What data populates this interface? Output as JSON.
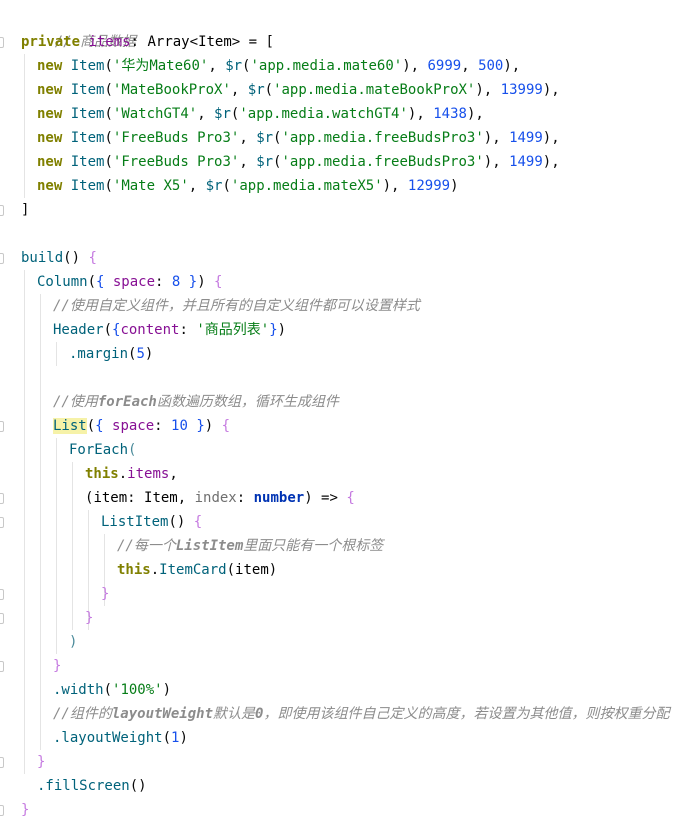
{
  "code": {
    "c_items": "// 商品数据",
    "kw_private": "private",
    "prop_items": "items",
    "type_array": "Array",
    "type_item": "Item",
    "kw_new": "new",
    "rows": [
      {
        "name": "'华为Mate60'",
        "res": "'app.media.mate60'",
        "price": "6999",
        "discount": "500"
      },
      {
        "name": "'MateBookProX'",
        "res": "'app.media.mateBookProX'",
        "price": "13999"
      },
      {
        "name": "'WatchGT4'",
        "res": "'app.media.watchGT4'",
        "price": "1438"
      },
      {
        "name": "'FreeBuds Pro3'",
        "res": "'app.media.freeBudsPro3'",
        "price": "1499"
      },
      {
        "name": "'FreeBuds Pro3'",
        "res": "'app.media.freeBudsPro3'",
        "price": "1499"
      },
      {
        "name": "'Mate X5'",
        "res": "'app.media.mateX5'",
        "price": "12999"
      }
    ],
    "fn_build": "build",
    "fn_column": "Column",
    "param_space": "space",
    "num_8": "8",
    "c_custom": "//使用自定义组件，并且所有的自定义组件都可以设置样式",
    "fn_header": "Header",
    "param_content": "content",
    "str_header": "'商品列表'",
    "fn_margin": ".margin",
    "num_5": "5",
    "c_foreach_a": "//使用",
    "c_foreach_b": "forEach",
    "c_foreach_c": "函数遍历数组，循环生成组件",
    "fn_list": "List",
    "num_10": "10",
    "fn_foreach": "ForEach",
    "kw_this": "this",
    "p_item": "item",
    "p_index": "index",
    "type_number": "number",
    "fn_listitem": "ListItem",
    "c_listitem_a": "//每一个",
    "c_listitem_b": "ListItem",
    "c_listitem_c": "里面只能有一个根标签",
    "fn_itemcard": "ItemCard",
    "fn_width": ".width",
    "str_100": "'100%'",
    "c_layout_a": "//组件的",
    "c_layout_b": "layoutWeight",
    "c_layout_c": "默认是",
    "c_layout_d": "0",
    "c_layout_e": "，即使用该组件自己定义的高度，若设置为其他值，则按权重分配",
    "fn_layoutweight": ".layoutWeight",
    "num_1": "1",
    "fn_fillscreen": ".fillScreen",
    "dollar_r": "$r"
  }
}
